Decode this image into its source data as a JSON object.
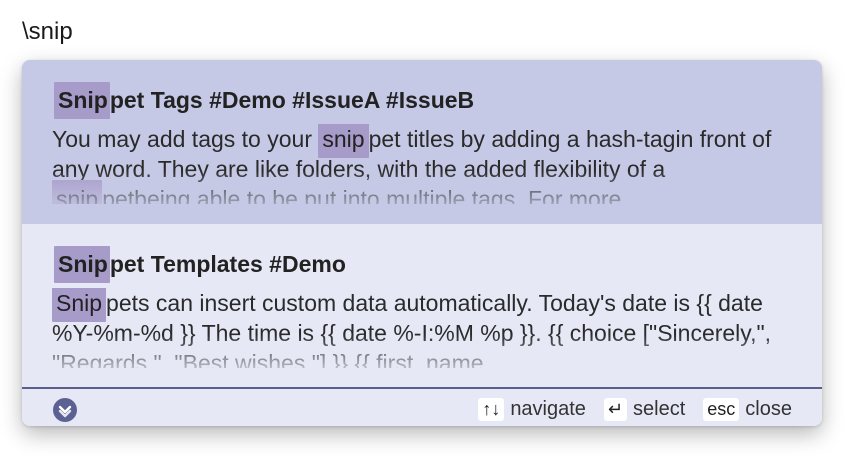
{
  "query": "\\snip",
  "results": [
    {
      "title_highlight": "Snip",
      "title_rest": "pet Tags #Demo #IssueA #IssueB",
      "body": [
        {
          "t": "You may add tags to your "
        },
        {
          "t": "snip",
          "h": true
        },
        {
          "t": "pet titles by adding a hash-tagin front of any word. They are like folders, with the added flexibility of a "
        },
        {
          "t": "snip",
          "h": true
        },
        {
          "t": "petbeing able to be put into multiple tags. For more"
        }
      ]
    },
    {
      "title_highlight": "Snip",
      "title_rest": "pet Templates #Demo",
      "body": [
        {
          "t": "Snip",
          "h": true
        },
        {
          "t": "pets can insert custom data automatically. Today's date is {{ date %Y-%m-%d }} The time is {{ date %-I:%M %p }}. {{ choice [\"Sincerely,\", \"Regards,\", \"Best wishes,\"] }} {{ first_name"
        }
      ]
    }
  ],
  "footer": {
    "logo_icon": "chevron-down-circle-icon",
    "navigate_key": "↑↓",
    "navigate_label": "navigate",
    "select_key": "↵",
    "select_label": "select",
    "close_key": "esc",
    "close_label": "close"
  },
  "colors": {
    "selected_bg": "#c6c9e5",
    "popup_bg": "#e6e8f6",
    "highlight": "#a79bc9",
    "accent": "#5b6193"
  }
}
